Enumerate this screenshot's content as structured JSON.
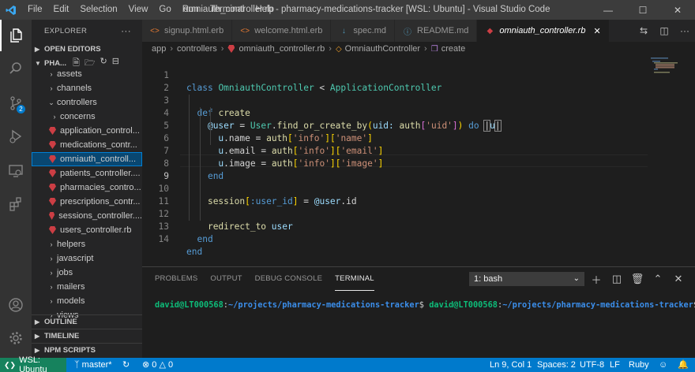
{
  "window": {
    "title": "omniauth_controller.rb - pharmacy-medications-tracker [WSL: Ubuntu] - Visual Studio Code",
    "menu": [
      "File",
      "Edit",
      "Selection",
      "View",
      "Go",
      "Run",
      "Terminal",
      "Help"
    ]
  },
  "activity_bar": {
    "scm_badge": "2"
  },
  "sidebar": {
    "title": "EXPLORER",
    "more": "···",
    "open_editors": "OPEN EDITORS",
    "root": "PHA...",
    "items": [
      {
        "label": "assets",
        "type": "folder"
      },
      {
        "label": "channels",
        "type": "folder"
      },
      {
        "label": "controllers",
        "type": "folder-open"
      },
      {
        "label": "concerns",
        "type": "folder"
      },
      {
        "label": "application_control...",
        "type": "ruby"
      },
      {
        "label": "medications_contr...",
        "type": "ruby"
      },
      {
        "label": "omniauth_controll...",
        "type": "ruby",
        "selected": true
      },
      {
        "label": "patients_controller....",
        "type": "ruby"
      },
      {
        "label": "pharmacies_contro...",
        "type": "ruby"
      },
      {
        "label": "prescriptions_contr...",
        "type": "ruby"
      },
      {
        "label": "sessions_controller....",
        "type": "ruby"
      },
      {
        "label": "users_controller.rb",
        "type": "ruby"
      },
      {
        "label": "helpers",
        "type": "folder"
      },
      {
        "label": "javascript",
        "type": "folder"
      },
      {
        "label": "jobs",
        "type": "folder"
      },
      {
        "label": "mailers",
        "type": "folder"
      },
      {
        "label": "models",
        "type": "folder"
      },
      {
        "label": "views",
        "type": "folder"
      }
    ],
    "outline": "OUTLINE",
    "timeline": "TIMELINE",
    "npm_scripts": "NPM SCRIPTS"
  },
  "tabs": [
    {
      "label": "signup.html.erb",
      "icon": "<>",
      "active": false
    },
    {
      "label": "welcome.html.erb",
      "icon": "<>",
      "active": false
    },
    {
      "label": "spec.md",
      "icon": "↓",
      "active": false
    },
    {
      "label": "README.md",
      "icon": "ⓘ",
      "active": false
    },
    {
      "label": "omniauth_controller.rb",
      "icon": "◆",
      "active": true
    }
  ],
  "breadcrumb": [
    "app",
    "controllers",
    "omniauth_controller.rb",
    "OmniauthController",
    "create"
  ],
  "editor": {
    "line_numbers": [
      "1",
      "2",
      "3",
      "4",
      "5",
      "6",
      "7",
      "8",
      "9",
      "10",
      "11",
      "12",
      "13",
      "14"
    ],
    "current_line": 9,
    "code": {
      "l1_kw": "class",
      "l1_cls": "OmniauthController",
      "l1_op": " < ",
      "l1_parent": "ApplicationController",
      "l3_kw": "def",
      "l3_fn": "create",
      "l4_var": "@user",
      "l4_eq": " = ",
      "l4_cls": "User",
      "l4_dot": ".",
      "l4_fn": "find_or_create_by",
      "l4_p1": "(",
      "l4_key": "uid:",
      "l4_sp": " ",
      "l4_fn2": "auth",
      "l4_b1": "[",
      "l4_str": "'uid'",
      "l4_b2": "]",
      "l4_p2": ")",
      "l4_do": " do ",
      "l4_pipe1": "|",
      "l4_u": "u",
      "l4_pipe2": "|",
      "l5_u": "u",
      "l5_prop": ".name",
      "l5_eq": " = ",
      "l5_fn": "auth",
      "l5_s1": "'info'",
      "l5_s2": "'name'",
      "l6_u": "u",
      "l6_prop": ".email",
      "l6_eq": " = ",
      "l6_fn": "auth",
      "l6_s1": "'info'",
      "l6_s2": "'email'",
      "l7_u": "u",
      "l7_prop": ".image",
      "l7_eq": " = ",
      "l7_fn": "auth",
      "l7_s1": "'info'",
      "l7_s2": "'image'",
      "l8_end": "end",
      "l10_fn": "session",
      "l10_sym": ":user_id",
      "l10_eq": " = ",
      "l10_var": "@user",
      "l10_prop": ".id",
      "l12_fn": "redirect_to",
      "l12_arg": " user",
      "l13_end": "end",
      "l14_end": "end",
      "lb": "[",
      "rb": "]"
    }
  },
  "panel": {
    "tabs": [
      "PROBLEMS",
      "OUTPUT",
      "DEBUG CONSOLE",
      "TERMINAL"
    ],
    "active_tab": "TERMINAL",
    "shell": "1: bash",
    "terminal": {
      "user1": "david@LT000568",
      "colon1": ":",
      "path1": "~/projects/pharmacy-medications-tracker",
      "prompt1": "$ ",
      "user2": "david@LT000568",
      "colon2": ":",
      "path2": "~/projects/pharmacy-medications-tracker",
      "prompt2": "$"
    }
  },
  "status_bar": {
    "remote": "WSL: Ubuntu",
    "branch": "master*",
    "errors": "0",
    "warnings": "0",
    "position": "Ln 9, Col 1",
    "spaces": "Spaces: 2",
    "encoding": "UTF-8",
    "eol": "LF",
    "language": "Ruby"
  }
}
